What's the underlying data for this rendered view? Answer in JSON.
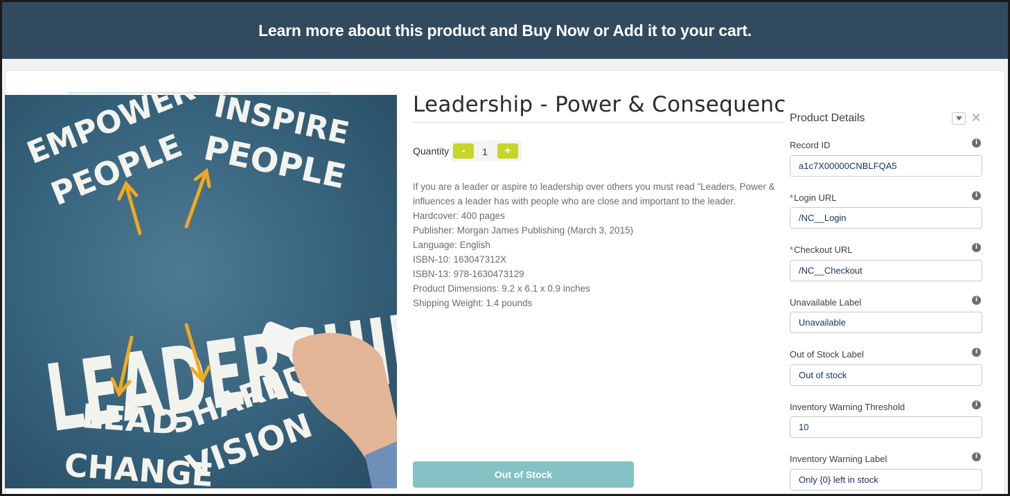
{
  "banner": {
    "text": "Learn more about this product and Buy Now or Add it to your cart."
  },
  "product": {
    "title": "Leadership - Power & Consequence",
    "image_words": {
      "empower_1": "EMPOWER",
      "empower_2": "PEOPLE",
      "inspire_1": "INSPIRE",
      "inspire_2": "PEOPLE",
      "main": "LEADERSHIP",
      "lead_1": "LEAD",
      "lead_2": "CHANGE",
      "shared_1": "SHARED",
      "shared_2": "VISION"
    },
    "quantity": {
      "label": "Quantity",
      "minus": "-",
      "value": "1",
      "plus": "+"
    },
    "description": [
      "If you are a leader or aspire to leadership over others you must read \"Leaders, Power &",
      "influences a leader has with people who are close and important to the leader.",
      "Hardcover: 400 pages",
      "Publisher: Morgan James Publishing (March 3, 2015)",
      "Language: English",
      "ISBN-10: 163047312X",
      "ISBN-13: 978-1630473129",
      "Product Dimensions: 9.2 x 6.1 x 0.9 inches",
      "Shipping Weight: 1.4 pounds"
    ],
    "stock_button": "Out of Stock"
  },
  "panel": {
    "title": "Product Details",
    "dropdown_icon": "chevron-down-icon",
    "close": "✕",
    "info": "i",
    "required_mark": "*",
    "fields": [
      {
        "label": "Record ID",
        "value": "a1c7X00000CNBLFQA5",
        "required": false
      },
      {
        "label": "Login URL",
        "value": "/NC__Login",
        "required": true
      },
      {
        "label": "Checkout URL",
        "value": "/NC__Checkout",
        "required": true
      },
      {
        "label": "Unavailable Label",
        "value": "Unavailable",
        "required": false
      },
      {
        "label": "Out of Stock Label",
        "value": "Out of stock",
        "required": false
      },
      {
        "label": "Inventory Warning Threshold",
        "value": "10",
        "required": false
      },
      {
        "label": "Inventory Warning Label",
        "value": "Only {0} left in stock",
        "required": false
      }
    ]
  },
  "colors": {
    "banner_bg": "#324a5e",
    "qty_button": "#c7d52a",
    "stock_button": "#83c1c5",
    "chalkboard": "#3a6680",
    "arrow": "#f2a81d"
  }
}
